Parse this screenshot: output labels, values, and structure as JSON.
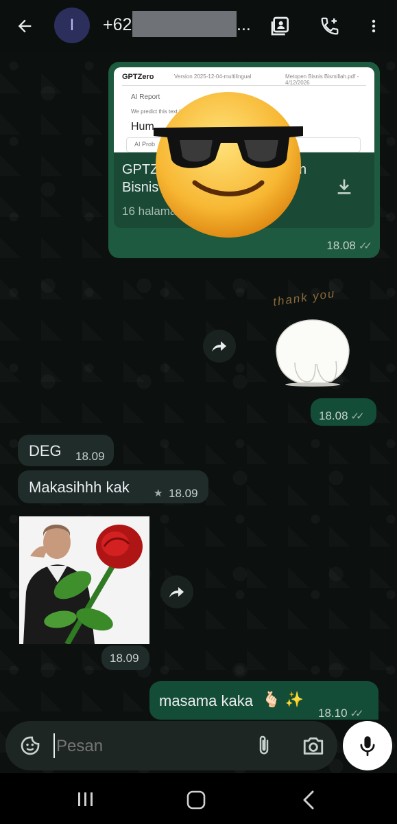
{
  "header": {
    "avatar_letter": "I",
    "contact_prefix": "+62",
    "contact_suffix": "..."
  },
  "document_message": {
    "preview_brand": "GPTZero",
    "preview_version": "Version 2025-12-04-multilingual",
    "preview_file": "Metopen Bisnis Bismillah.pdf - 4/12/2026",
    "preview_section": "AI Report",
    "preview_predict": "We predict this text is",
    "preview_result": "Hum",
    "preview_prob": "AI Prob",
    "title_line1": "GPTZ",
    "title_line1_end": "n",
    "title_line2": "Bisnis",
    "pages": "16 halama",
    "time": "18.08"
  },
  "sticker_message": {
    "caption": "thank you",
    "time": "18.08"
  },
  "messages": [
    {
      "text": "DEG",
      "time": "18.09"
    },
    {
      "text": "Makasihhh kak",
      "time": "18.09",
      "starred": true
    }
  ],
  "image_message": {
    "time": "18.09"
  },
  "reply_message": {
    "text": "masama kaka",
    "emoji": "🫰🏻 ✨",
    "time": "18.10"
  },
  "composer": {
    "placeholder": "Pesan"
  },
  "colors": {
    "outgoing_bubble": "#144d37",
    "incoming_bubble": "#1f2c2a",
    "accent": "#25d366"
  }
}
